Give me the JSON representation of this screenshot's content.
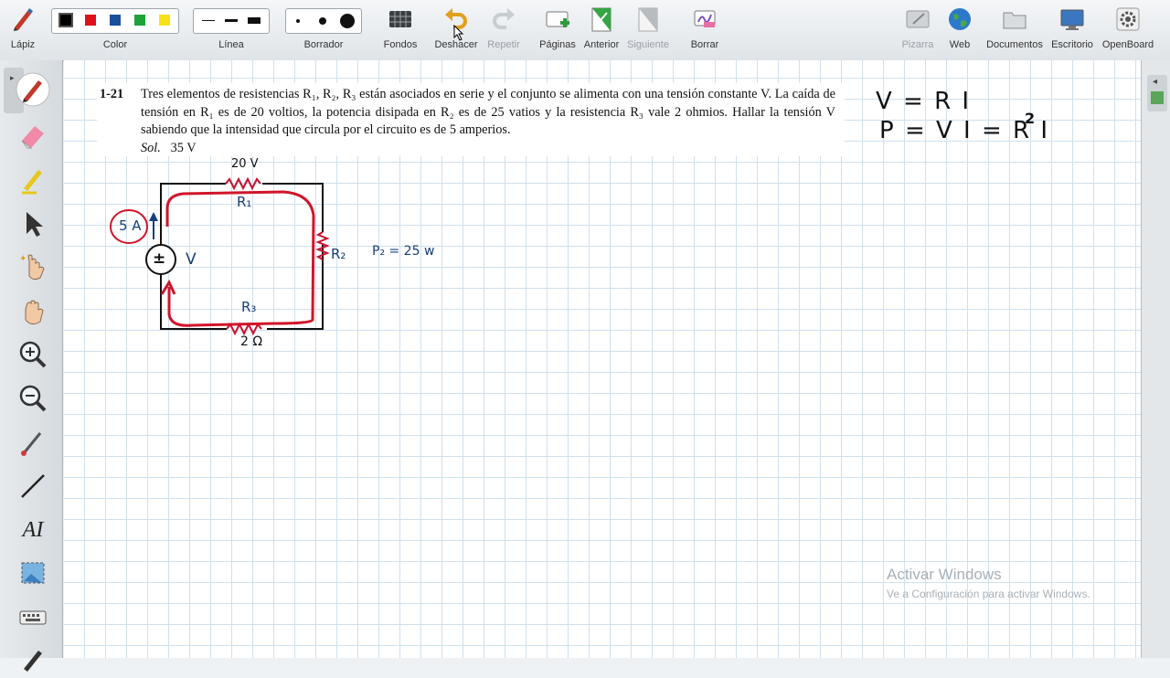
{
  "toolbar": {
    "pen": "Lápiz",
    "color": "Color",
    "line": "Línea",
    "eraser": "Borrador",
    "backgrounds": "Fondos",
    "undo": "Deshacer",
    "redo": "Repetir",
    "pages": "Páginas",
    "previous": "Anterior",
    "next": "Siguiente",
    "clear": "Borrar",
    "board": "Pizarra",
    "web": "Web",
    "documents": "Documentos",
    "desktop": "Escritorio",
    "openboard": "OpenBoard"
  },
  "colors": [
    "#000000",
    "#e0101a",
    "#1a4f9c",
    "#1ea33a",
    "#f6e21a"
  ],
  "selected_color": "#000000",
  "problem": {
    "number": "1-21",
    "text": "Tres elementos de resistencias R₁, R₂, R₃ están asociados en serie y el conjunto se alimenta con una tensión constante V. La caída de tensión en R₁ es de 20 voltios, la potencia disipada en R₂ es de 25 vatios y la resistencia R₃ vale 2 ohmios. Hallar la tensión V sabiendo que la intensidad que circula por el circuito es de 5 amperios.",
    "solution_label": "Sol.",
    "solution_value": "35 V"
  },
  "circuit": {
    "r1_voltage": "20 V",
    "r1_label": "R₁",
    "r2_label": "R₂",
    "r3_label": "R₃",
    "r3_value": "2 Ω",
    "source_label": "V",
    "source_symbol": "±",
    "current": "5 A",
    "p2": "P₂ = 25 w"
  },
  "formulas": {
    "line1": "V = R I",
    "line2": "P = V I = R I",
    "exponent": "2"
  },
  "watermark": {
    "title": "Activar Windows",
    "subtitle": "Ve a Configuración para activar Windows."
  }
}
